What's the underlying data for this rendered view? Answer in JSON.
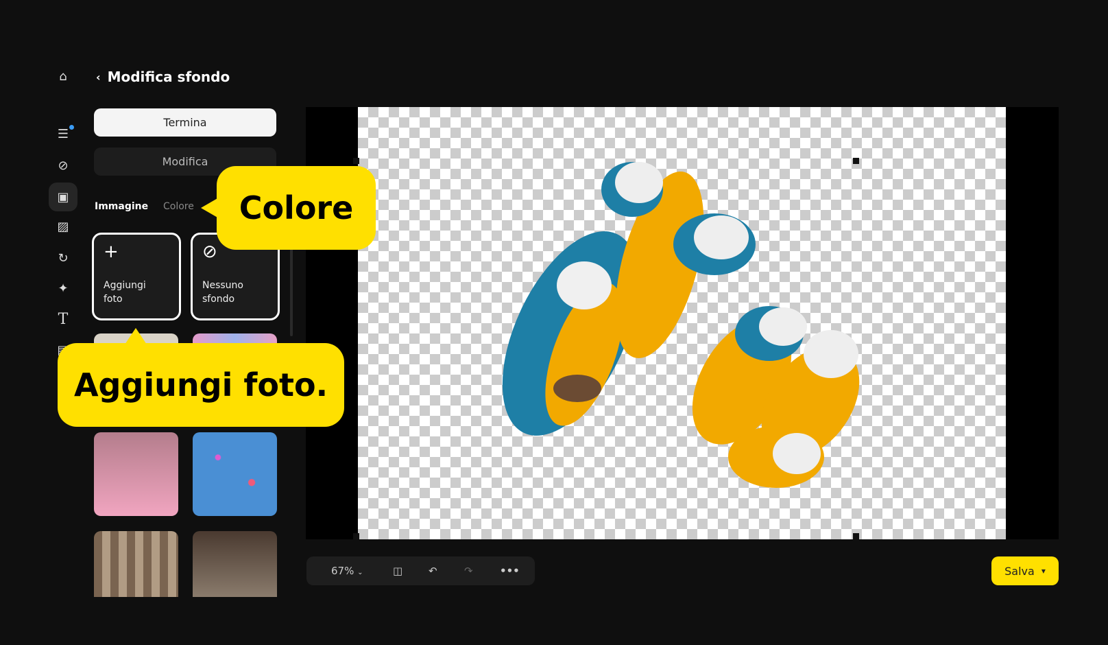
{
  "header": {
    "back_icon": "chevron-left",
    "title": "Modifica sfondo"
  },
  "sidebar": {
    "icons": [
      "home-icon",
      "sliders-icon",
      "bandage-icon",
      "portrait-icon",
      "image-edit-icon",
      "rotate-icon",
      "sparkle-icon",
      "text-icon",
      "layout-icon"
    ]
  },
  "panel": {
    "termina_label": "Termina",
    "modifica_label": "Modifica",
    "tabs": [
      {
        "label": "Immagine",
        "active": true
      },
      {
        "label": "Colore",
        "active": false
      }
    ],
    "cards": [
      {
        "label": "Aggiungi foto",
        "icon": "plus-icon"
      },
      {
        "label": "Nessuno sfondo",
        "icon": "no-icon"
      }
    ]
  },
  "callouts": {
    "colore": "Colore",
    "aggiungi": "Aggiungi foto."
  },
  "toolbar": {
    "zoom": "67%"
  },
  "save": {
    "label": "Salva"
  },
  "colors": {
    "accent": "#ffe000",
    "bg": "#0f0f0f"
  }
}
